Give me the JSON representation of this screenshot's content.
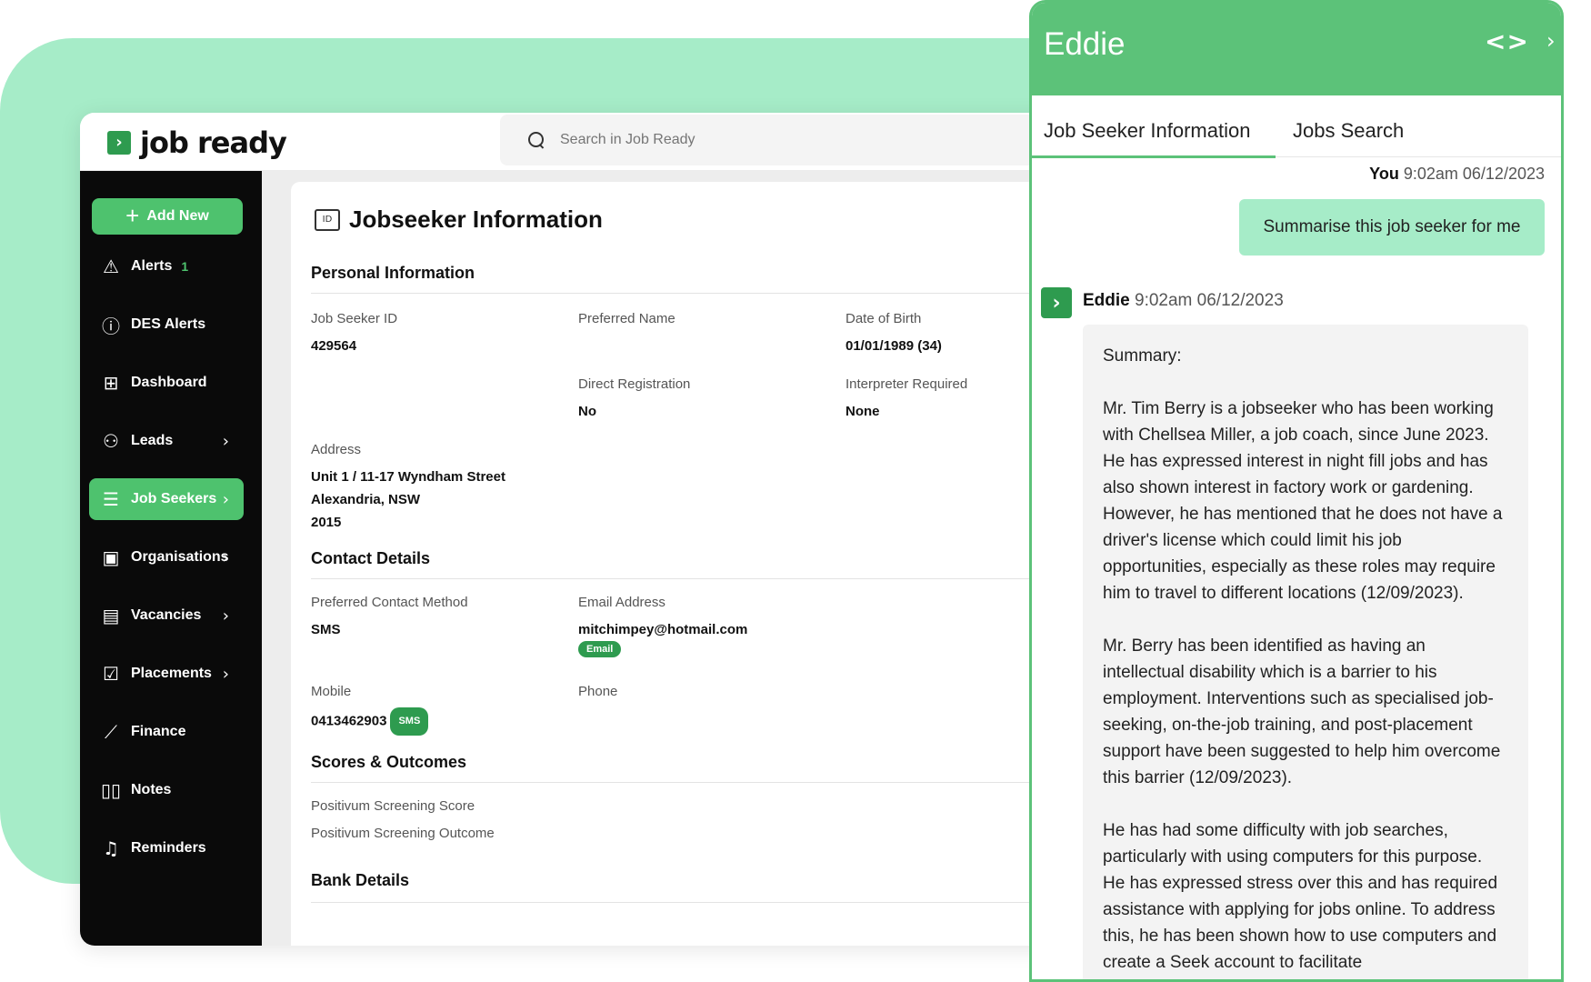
{
  "app": {
    "logo_text": "job ready",
    "search_placeholder": "Search in Job Ready"
  },
  "sidebar": {
    "add_new": "Add New",
    "items": [
      {
        "label": "Alerts",
        "icon": "warning-icon",
        "badge": "1"
      },
      {
        "label": "DES Alerts",
        "icon": "info-circle-icon"
      },
      {
        "label": "Dashboard",
        "icon": "grid-icon"
      },
      {
        "label": "Leads",
        "icon": "user-plus-icon",
        "chevron": true
      },
      {
        "label": "Job Seekers",
        "icon": "user-list-icon",
        "chevron": true,
        "active": true
      },
      {
        "label": "Organisations",
        "icon": "building-icon",
        "chevron": true
      },
      {
        "label": "Vacancies",
        "icon": "document-icon",
        "chevron": true
      },
      {
        "label": "Placements",
        "icon": "clipboard-icon",
        "chevron": true
      },
      {
        "label": "Finance",
        "icon": "chart-line-icon"
      },
      {
        "label": "Notes",
        "icon": "book-icon"
      },
      {
        "label": "Reminders",
        "icon": "bell-icon"
      }
    ]
  },
  "main": {
    "title": "Jobseeker Information",
    "personal": {
      "heading": "Personal Information",
      "job_seeker_id_label": "Job Seeker ID",
      "job_seeker_id": "429564",
      "preferred_name_label": "Preferred Name",
      "dob_label": "Date of Birth",
      "dob": "01/01/1989 (34)",
      "direct_reg_label": "Direct Registration",
      "direct_reg": "No",
      "interpreter_label": "Interpreter Required",
      "interpreter": "None",
      "address_label": "Address",
      "address_line1": "Unit 1 / 11-17 Wyndham Street",
      "address_line2": "Alexandria, NSW",
      "address_line3": "2015"
    },
    "contact": {
      "heading": "Contact Details",
      "method_label": "Preferred Contact Method",
      "method": "SMS",
      "email_label": "Email Address",
      "email": "mitchimpey@hotmail.com",
      "email_pill": "Email",
      "mobile_label": "Mobile",
      "mobile": "0413462903",
      "sms_pill": "SMS",
      "phone_label": "Phone"
    },
    "scores": {
      "heading": "Scores & Outcomes",
      "score_label": "Positivum Screening Score",
      "outcome_label": "Positivum Screening Outcome"
    },
    "bank": {
      "heading": "Bank Details"
    }
  },
  "eddie": {
    "title": "Eddie",
    "tabs": [
      "Job Seeker Information",
      "Jobs Search"
    ],
    "user_name": "You",
    "user_time": "9:02am 06/12/2023",
    "user_message": "Summarise this job seeker for me",
    "bot_name": "Eddie",
    "bot_time": "9:02am 06/12/2023",
    "bot_paragraphs": [
      "Summary:",
      "Mr. Tim Berry is a jobseeker who has been working with Chellsea Miller, a job coach, since June 2023. He has expressed interest in night fill jobs and has also shown interest in factory work or gardening. However, he has mentioned that he does not have a driver's license which could limit his job opportunities, especially as these roles may require him to travel to different locations (12/09/2023).",
      "Mr. Berry has been identified as having an intellectual disability which is a barrier to his employment. Interventions such as specialised job-seeking, on-the-job training, and post-placement support have been suggested to help him overcome this barrier (12/09/2023).",
      "He has had some difficulty with job searches, particularly with using computers for this purpose. He has expressed stress over this and has required assistance with applying for jobs online. To address this, he has been shown how to use computers and create a Seek account to facilitate"
    ]
  }
}
